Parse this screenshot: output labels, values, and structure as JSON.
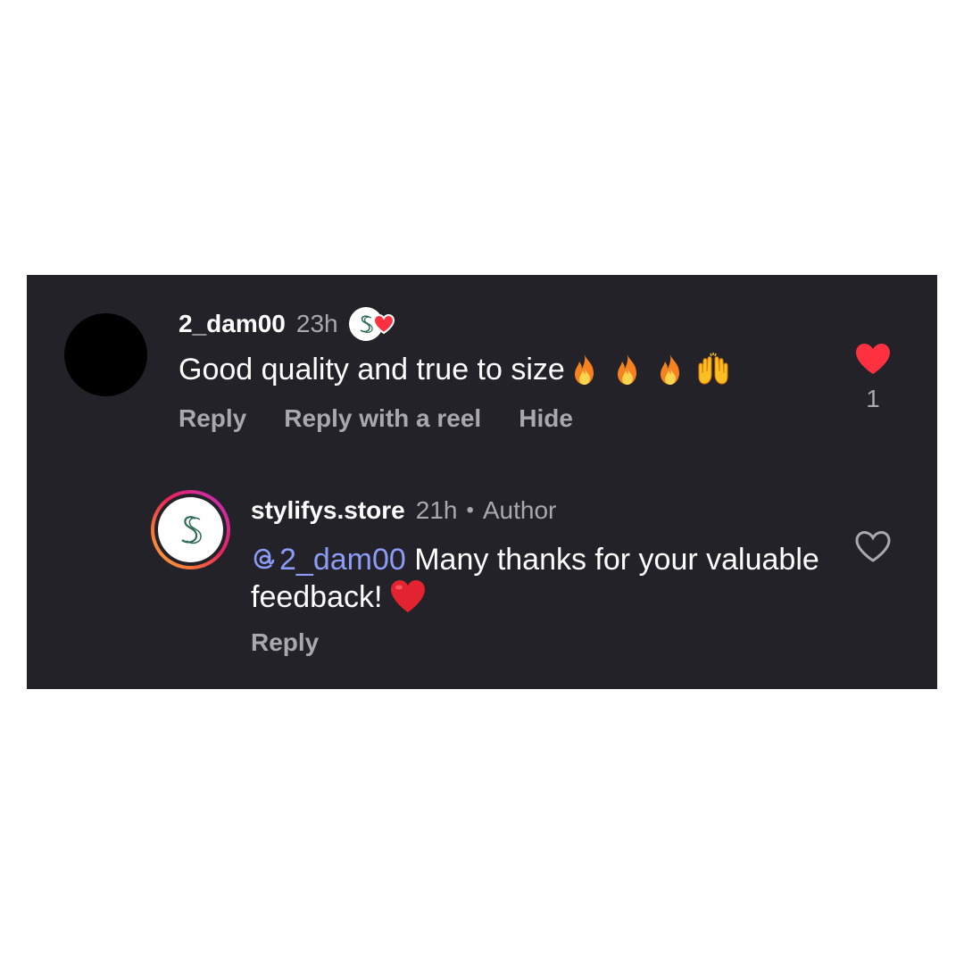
{
  "comment": {
    "username": "2_dam00",
    "time": "23h",
    "liked_by_author_icon": "author-liked-heart-icon",
    "text": "Good quality and true to size",
    "emojis": [
      "fire-emoji",
      "fire-emoji",
      "fire-emoji",
      "raising-hands-emoji"
    ],
    "actions": {
      "reply": "Reply",
      "reply_reel": "Reply with a reel",
      "hide": "Hide"
    },
    "like_count": "1",
    "liked": true
  },
  "reply": {
    "username": "stylifys.store",
    "time": "21h",
    "separator": "•",
    "badge": "Author",
    "mention": "2_dam00",
    "text_before_heart": " Many thanks for your valuable feedback!",
    "heart_emoji": "red-heart-emoji",
    "actions": {
      "reply": "Reply"
    },
    "liked": false
  },
  "colors": {
    "panel_background": "#222228",
    "text_primary": "#ffffff",
    "text_secondary": "#a8a8ae",
    "like_red": "#ff3040",
    "mention_blue": "#8c9cf5",
    "brand_green": "#2f6b57"
  }
}
